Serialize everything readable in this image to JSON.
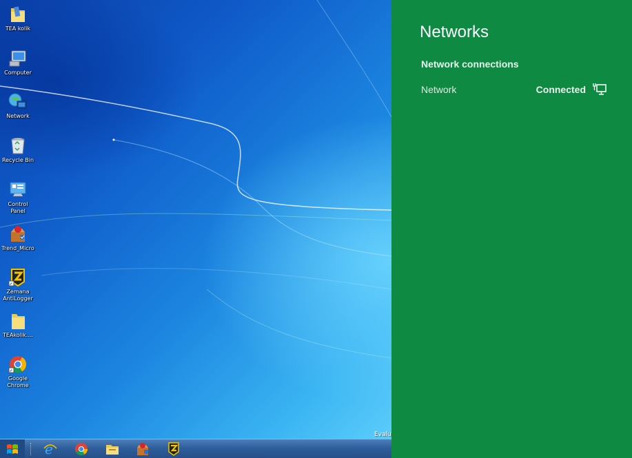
{
  "desktop": {
    "icons": [
      {
        "label": "TEA kolik",
        "icon": "folder-icon"
      },
      {
        "label": "Computer",
        "icon": "computer-icon"
      },
      {
        "label": "Network",
        "icon": "network-globe-icon"
      },
      {
        "label": "Recycle Bin",
        "icon": "recycle-bin-icon"
      },
      {
        "label": "Control Panel",
        "icon": "control-panel-icon"
      },
      {
        "label": "Trend_Micro",
        "icon": "trend-micro-icon"
      },
      {
        "label": "Zemana AntiLogger",
        "icon": "zemana-icon"
      },
      {
        "label": "TEAkolik....",
        "icon": "folder-icon"
      },
      {
        "label": "Google Chrome",
        "icon": "chrome-icon"
      }
    ],
    "watermark": "Evalu"
  },
  "taskbar": {
    "items": [
      "start-orb-icon",
      "internet-explorer-icon",
      "chrome-icon",
      "file-explorer-icon",
      "trend-micro-icon",
      "zemana-icon"
    ]
  },
  "networks_panel": {
    "title": "Networks",
    "section_heading": "Network connections",
    "connections": [
      {
        "name": "Network",
        "status": "Connected",
        "icon": "wired-network-icon"
      }
    ],
    "background_color": "#0f8a43"
  }
}
